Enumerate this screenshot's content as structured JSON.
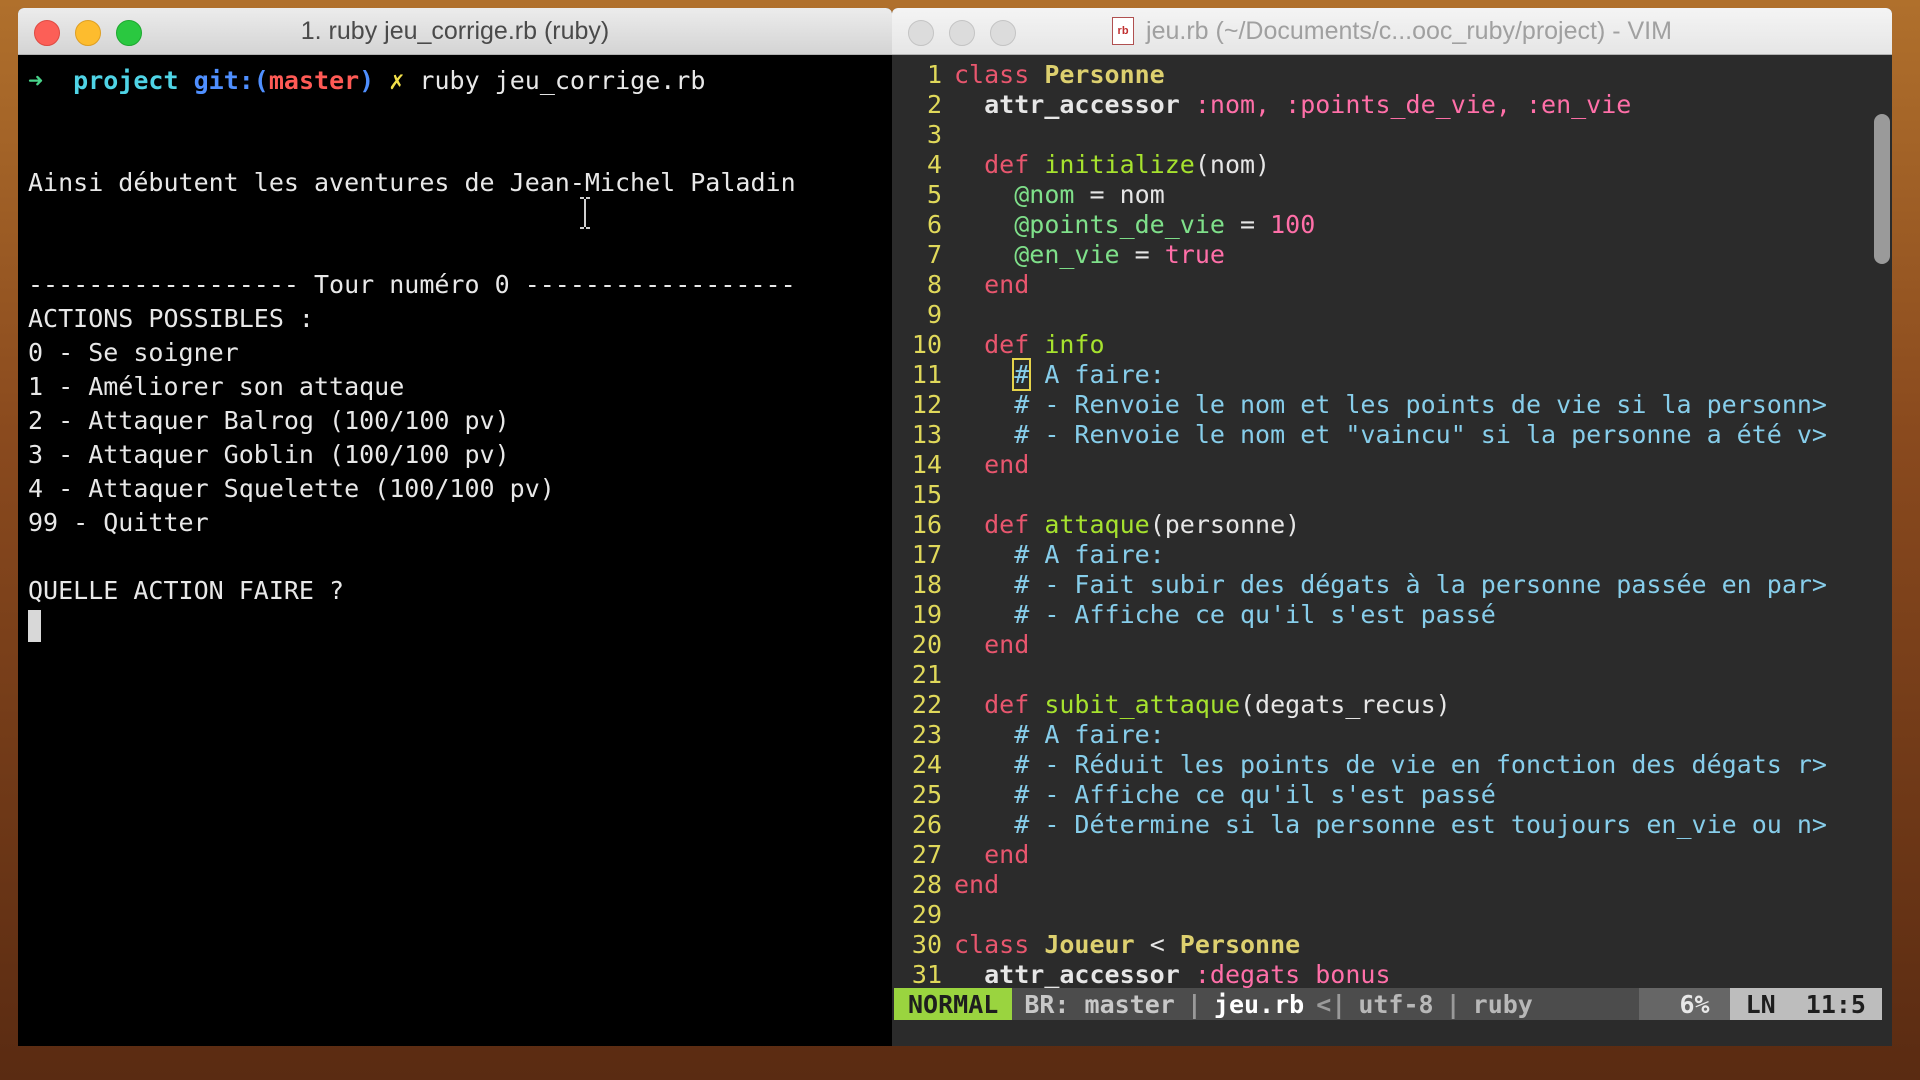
{
  "terminal": {
    "title": "1. ruby jeu_corrige.rb (ruby)",
    "prompt": {
      "arrow": "➜",
      "dir": "project",
      "git": "git:(",
      "branch": "master",
      "git_close": ")",
      "dirty": "✗",
      "command": "ruby jeu_corrige.rb"
    },
    "lines": [
      "Ainsi débutent les aventures de Jean-Michel Paladin",
      "------------------ Tour numéro 0 ------------------",
      "ACTIONS POSSIBLES :",
      "0 - Se soigner",
      "1 - Améliorer son attaque",
      "2 - Attaquer Balrog (100/100 pv)",
      "3 - Attaquer Goblin (100/100 pv)",
      "4 - Attaquer Squelette (100/100 pv)",
      "99 - Quitter",
      "QUELLE ACTION FAIRE ?"
    ]
  },
  "vim": {
    "title": "jeu.rb (~/Documents/c...ooc_ruby/project) - VIM",
    "file_icon": "rb",
    "line_numbers": [
      "1",
      "2",
      "3",
      "4",
      "5",
      "6",
      "7",
      "8",
      "9",
      "10",
      "11",
      "12",
      "13",
      "14",
      "15",
      "16",
      "17",
      "18",
      "19",
      "20",
      "21",
      "22",
      "23",
      "24",
      "25",
      "26",
      "27",
      "28",
      "29",
      "30",
      "31"
    ],
    "code": {
      "l1": {
        "kw": "class",
        "name": "Personne"
      },
      "l2": {
        "kw": "attr_accessor",
        "syms": ":nom, :points_de_vie, :en_vie"
      },
      "l4": {
        "kw": "def",
        "fn": "initialize",
        "args": "(nom)"
      },
      "l5": {
        "ivar": "@nom",
        "rest": " = nom"
      },
      "l6": {
        "ivar": "@points_de_vie",
        "rest": " = ",
        "val": "100"
      },
      "l7": {
        "ivar": "@en_vie",
        "rest": " = ",
        "val": "true"
      },
      "end": "end",
      "l10": {
        "kw": "def",
        "fn": "info"
      },
      "l11": {
        "hash": "#",
        "text": " A faire:"
      },
      "l12": "# - Renvoie le nom et les points de vie si la personn>",
      "l13": "# - Renvoie le nom et \"vaincu\" si la personne a été v>",
      "l16": {
        "kw": "def",
        "fn": "attaque",
        "args": "(personne)"
      },
      "l17": "# A faire:",
      "l18": "# - Fait subir des dégats à la personne passée en par>",
      "l19": "# - Affiche ce qu'il s'est passé",
      "l22": {
        "kw": "def",
        "fn": "subit_attaque",
        "args": "(degats_recus)"
      },
      "l23": "# A faire:",
      "l24": "# - Réduit les points de vie en fonction des dégats r>",
      "l25": "# - Affiche ce qu'il s'est passé",
      "l26": "# - Détermine si la personne est toujours en_vie ou n>",
      "l30": {
        "kw": "class",
        "name": "Joueur",
        "op": " < ",
        "parent": "Personne"
      },
      "l31": {
        "kw": "attr_accessor",
        "syms": ":degats_bonus"
      }
    },
    "status": {
      "mode": "NORMAL",
      "branch": "BR: master",
      "sep": "|",
      "file": "jeu.rb",
      "flag": "<|",
      "encoding": "utf-8",
      "filetype": "ruby",
      "percent": "6%",
      "ln_label": "LN",
      "position": "11:5"
    }
  }
}
